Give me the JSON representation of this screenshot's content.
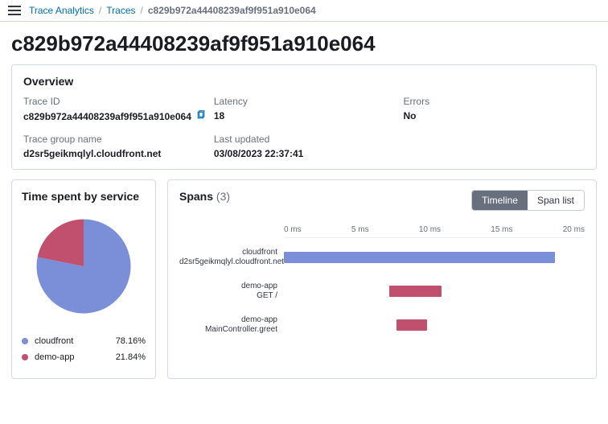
{
  "breadcrumb": {
    "root": "Trace Analytics",
    "mid": "Traces",
    "current": "c829b972a44408239af9f951a910e064"
  },
  "page_title": "c829b972a44408239af9f951a910e064",
  "overview": {
    "title": "Overview",
    "trace_id_label": "Trace ID",
    "trace_id": "c829b972a44408239af9f951a910e064",
    "latency_label": "Latency",
    "latency": "18",
    "errors_label": "Errors",
    "errors": "No",
    "group_label": "Trace group name",
    "group": "d2sr5geikmqlyl.cloudfront.net",
    "updated_label": "Last updated",
    "updated": "03/08/2023 22:37:41"
  },
  "time_panel": {
    "title": "Time spent by service",
    "legend": [
      {
        "name": "cloudfront",
        "pct": "78.16%",
        "color": "#7b8fd9"
      },
      {
        "name": "demo-app",
        "pct": "21.84%",
        "color": "#c14f6e"
      }
    ]
  },
  "spans_panel": {
    "title": "Spans",
    "count": "(3)",
    "toggle_timeline": "Timeline",
    "toggle_spanlist": "Span list",
    "axis": [
      "0 ms",
      "5 ms",
      "10 ms",
      "15 ms",
      "20 ms"
    ],
    "rows": [
      {
        "service": "cloudfront",
        "op": "d2sr5geikmqlyl.cloudfront.net",
        "start_ms": 0,
        "end_ms": 18,
        "color": "#7b8fd9"
      },
      {
        "service": "demo-app",
        "op": "GET /",
        "start_ms": 7,
        "end_ms": 10.5,
        "color": "#c14f6e"
      },
      {
        "service": "demo-app",
        "op": "MainController.greet",
        "start_ms": 7.5,
        "end_ms": 9.5,
        "color": "#c14f6e"
      }
    ],
    "range_ms": 20
  },
  "chart_data": {
    "type": "pie",
    "title": "Time spent by service",
    "series": [
      {
        "name": "cloudfront",
        "value": 78.16
      },
      {
        "name": "demo-app",
        "value": 21.84
      }
    ]
  },
  "colors": {
    "blue": "#7b8fd9",
    "pink": "#c14f6e"
  }
}
